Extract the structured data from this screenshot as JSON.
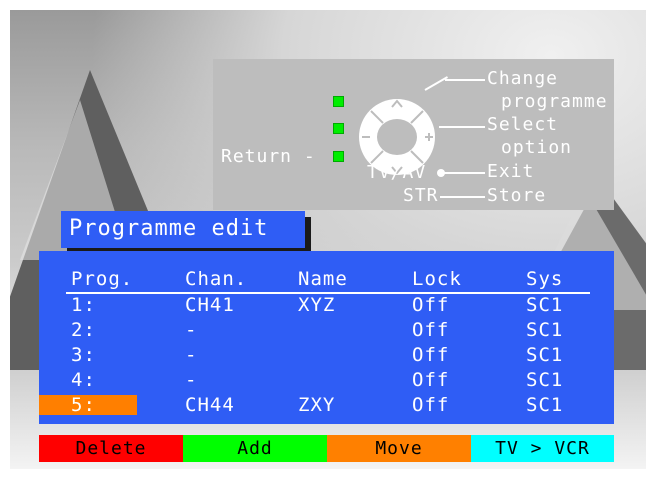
{
  "help": {
    "change_line1": "Change",
    "change_line2": "programme",
    "select_line1": "Select",
    "select_line2": "option",
    "exit": "Exit",
    "store": "Store",
    "return": "Return -",
    "tvav": "TV/AV",
    "str": "STR"
  },
  "title": "Programme edit",
  "table": {
    "headers": [
      "Prog.",
      "Chan.",
      "Name",
      "Lock",
      "Sys"
    ],
    "rows": [
      {
        "prog": "1:",
        "chan": "CH41",
        "name": "XYZ",
        "lock": "Off",
        "sys": "SC1"
      },
      {
        "prog": "2:",
        "chan": "-",
        "name": "",
        "lock": "Off",
        "sys": "SC1"
      },
      {
        "prog": "3:",
        "chan": "-",
        "name": "",
        "lock": "Off",
        "sys": "SC1"
      },
      {
        "prog": "4:",
        "chan": "-",
        "name": "",
        "lock": "Off",
        "sys": "SC1"
      },
      {
        "prog": "5:",
        "chan": "CH44",
        "name": "ZXY",
        "lock": "Off",
        "sys": "SC1"
      }
    ],
    "selected_row": 4
  },
  "buttons": {
    "delete": "Delete",
    "add": "Add",
    "move": "Move",
    "tvvcr": "TV > VCR"
  },
  "colors": {
    "panel_blue": "#2f5df5",
    "selection_orange": "#ff7f00",
    "delete_red": "#ff0000",
    "add_green": "#00ff00",
    "move_orange": "#ff8000",
    "tvvcr_cyan": "#00ffff"
  }
}
